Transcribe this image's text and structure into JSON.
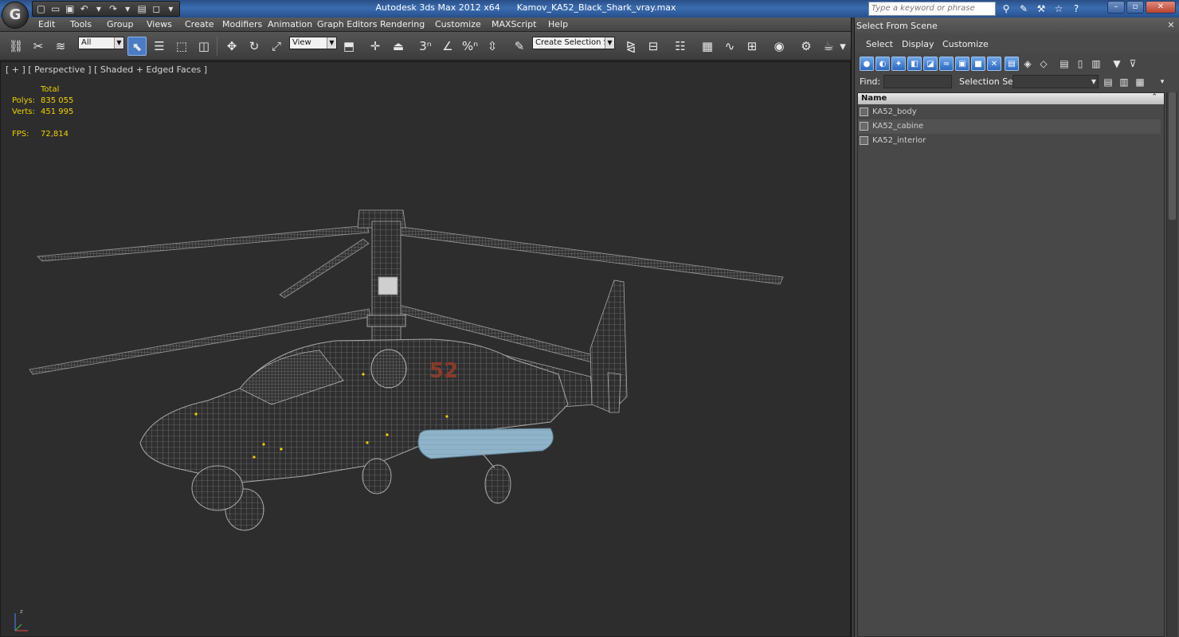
{
  "titlebar": {
    "app_title": "Autodesk 3ds Max  2012 x64",
    "file_name": "Kamov_KA52_Black_Shark_vray.max",
    "search_placeholder": "Type a keyword or phrase",
    "logo_glyph": "G"
  },
  "menubar": {
    "items": [
      "Edit",
      "Tools",
      "Group",
      "Views",
      "Create",
      "Modifiers",
      "Animation",
      "Graph Editors",
      "Rendering",
      "Customize",
      "MAXScript",
      "Help"
    ]
  },
  "toolbar": {
    "selection_filter": "All",
    "reference_coord": "View",
    "named_selection": "Create Selection Se",
    "snap_3d_label": "3",
    "percent_snap_label": "%"
  },
  "viewport": {
    "label": "[ + ] [ Perspective ] [ Shaded + Edged Faces ]",
    "stats": {
      "header": "Total",
      "polys_label": "Polys:",
      "polys_value": "835 055",
      "verts_label": "Verts:",
      "verts_value": "451 995",
      "fps_label": "FPS:",
      "fps_value": "72,814"
    },
    "model_marking": "52",
    "colors": {
      "background": "#2d2d2d",
      "wire": "#9a9a9a",
      "tank": "#8fb3c8",
      "stats": "#f0d200"
    }
  },
  "panel": {
    "title": "Select From Scene",
    "menu": [
      "Select",
      "Display",
      "Customize"
    ],
    "find_label": "Find:",
    "find_value": "",
    "selection_set_label": "Selection Set:",
    "list_header": "Name",
    "items": [
      "KA52_body",
      "KA52_cabine",
      "KA52_interior"
    ]
  }
}
